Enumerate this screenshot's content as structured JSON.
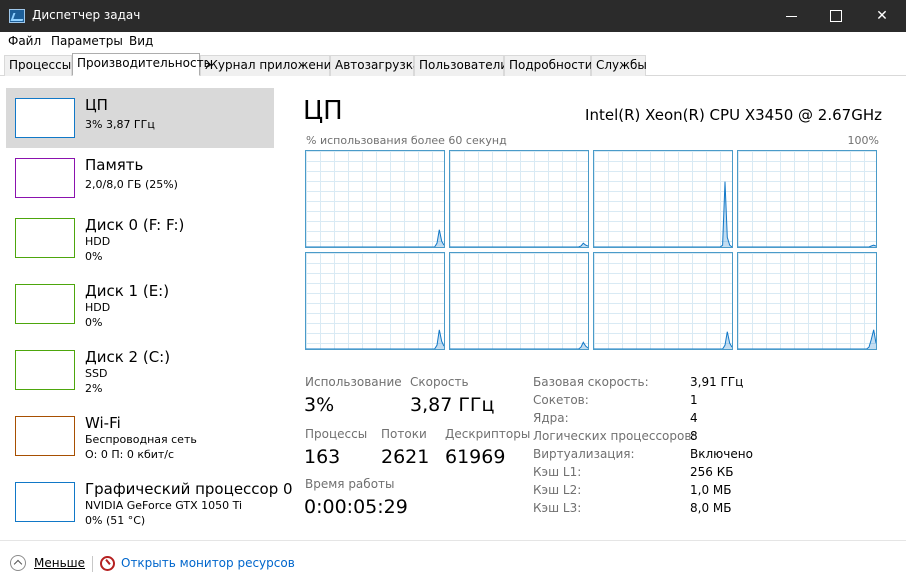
{
  "window": {
    "title": "Диспетчер задач"
  },
  "menu": [
    "Файл",
    "Параметры",
    "Вид"
  ],
  "tabs": [
    "Процессы",
    "Производительность",
    "Журнал приложений",
    "Автозагрузка",
    "Пользователи",
    "Подробности",
    "Службы"
  ],
  "active_tab": "Производительность",
  "left_items": [
    {
      "name": "ЦП",
      "sub1": "3% 3,87 ГГц",
      "sub2": "",
      "color": "#1178c7"
    },
    {
      "name": "Память",
      "sub1": "2,0/8,0 ГБ (25%)",
      "sub2": "",
      "color": "#8b12ae"
    },
    {
      "name": "Диск 0 (F: F:)",
      "sub1": "HDD",
      "sub2": "0%",
      "color": "#4da60c"
    },
    {
      "name": "Диск 1 (E:)",
      "sub1": "HDD",
      "sub2": "0%",
      "color": "#4da60c"
    },
    {
      "name": "Диск 2 (C:)",
      "sub1": "SSD",
      "sub2": "2%",
      "color": "#4da60c"
    },
    {
      "name": "Wi-Fi",
      "sub1": "Беспроводная сеть",
      "sub2": "О: 0 П: 0 кбит/с",
      "color": "#a74f01"
    },
    {
      "name": "Графический процессор 0",
      "sub1": "NVIDIA GeForce GTX 1050 Ti",
      "sub2": "0% (51 °C)",
      "color": "#1178c7"
    }
  ],
  "cpu": {
    "title": "ЦП",
    "model": "Intel(R) Xeon(R) CPU X3450 @ 2.67GHz",
    "graph_label": "% использования более 60 секунд",
    "graph_max": "100%",
    "graph_color": "#1178c7",
    "cores": [
      [
        0,
        0,
        0,
        0,
        0,
        0,
        0,
        0,
        0,
        0,
        0,
        0,
        0,
        0,
        0,
        0,
        0,
        0,
        0,
        0,
        0,
        0,
        0,
        0,
        0,
        0,
        0,
        0,
        0,
        0,
        0,
        0,
        0,
        0,
        0,
        0,
        0,
        0,
        0,
        0,
        0,
        0,
        0,
        0,
        0,
        0,
        0,
        0,
        0,
        0,
        0,
        0,
        0,
        0,
        0,
        0,
        4,
        18,
        6,
        2
      ],
      [
        0,
        0,
        0,
        0,
        0,
        0,
        0,
        0,
        0,
        0,
        0,
        0,
        0,
        0,
        0,
        0,
        0,
        0,
        0,
        0,
        0,
        0,
        0,
        0,
        0,
        0,
        0,
        0,
        0,
        0,
        0,
        0,
        0,
        0,
        0,
        0,
        0,
        0,
        0,
        0,
        0,
        0,
        0,
        0,
        0,
        0,
        0,
        0,
        0,
        0,
        0,
        0,
        0,
        0,
        0,
        0,
        1,
        4,
        2,
        1
      ],
      [
        0,
        0,
        0,
        0,
        0,
        0,
        0,
        0,
        0,
        0,
        0,
        0,
        0,
        0,
        0,
        0,
        0,
        0,
        0,
        0,
        0,
        0,
        0,
        0,
        0,
        0,
        0,
        0,
        0,
        0,
        0,
        0,
        0,
        0,
        0,
        0,
        0,
        0,
        0,
        0,
        0,
        0,
        0,
        0,
        0,
        0,
        0,
        0,
        0,
        0,
        0,
        0,
        0,
        0,
        0,
        2,
        68,
        10,
        2,
        0
      ],
      [
        0,
        0,
        0,
        0,
        0,
        0,
        0,
        0,
        0,
        0,
        0,
        0,
        0,
        0,
        0,
        0,
        0,
        0,
        0,
        0,
        0,
        0,
        0,
        0,
        0,
        0,
        0,
        0,
        0,
        0,
        0,
        0,
        0,
        0,
        0,
        0,
        0,
        0,
        0,
        0,
        0,
        0,
        0,
        0,
        0,
        0,
        0,
        0,
        0,
        0,
        0,
        0,
        0,
        0,
        0,
        0,
        0,
        1,
        2,
        1
      ],
      [
        0,
        0,
        0,
        0,
        0,
        0,
        0,
        0,
        0,
        0,
        0,
        0,
        0,
        0,
        0,
        0,
        0,
        0,
        0,
        0,
        0,
        0,
        0,
        0,
        0,
        0,
        0,
        0,
        0,
        0,
        0,
        0,
        0,
        0,
        0,
        0,
        0,
        0,
        0,
        0,
        0,
        0,
        0,
        0,
        0,
        0,
        0,
        0,
        0,
        0,
        0,
        0,
        0,
        0,
        0,
        0,
        4,
        20,
        8,
        3
      ],
      [
        0,
        0,
        0,
        0,
        0,
        0,
        0,
        0,
        0,
        0,
        0,
        0,
        0,
        0,
        0,
        0,
        0,
        0,
        0,
        0,
        0,
        0,
        0,
        0,
        0,
        0,
        0,
        0,
        0,
        0,
        0,
        0,
        0,
        0,
        0,
        0,
        0,
        0,
        0,
        0,
        0,
        0,
        0,
        0,
        0,
        0,
        0,
        0,
        0,
        0,
        0,
        0,
        0,
        0,
        0,
        0,
        2,
        7,
        3,
        1
      ],
      [
        0,
        0,
        0,
        0,
        0,
        0,
        0,
        0,
        0,
        0,
        0,
        0,
        0,
        0,
        0,
        0,
        0,
        0,
        0,
        0,
        0,
        0,
        0,
        0,
        0,
        0,
        0,
        0,
        0,
        0,
        0,
        0,
        0,
        0,
        0,
        0,
        0,
        0,
        0,
        0,
        0,
        0,
        0,
        0,
        0,
        0,
        0,
        0,
        0,
        0,
        0,
        0,
        0,
        0,
        0,
        0,
        4,
        18,
        6,
        2
      ],
      [
        0,
        0,
        0,
        0,
        0,
        0,
        0,
        0,
        0,
        0,
        0,
        0,
        0,
        0,
        0,
        0,
        0,
        0,
        0,
        0,
        0,
        0,
        0,
        0,
        0,
        0,
        0,
        0,
        0,
        0,
        0,
        0,
        0,
        0,
        0,
        0,
        0,
        0,
        0,
        0,
        0,
        0,
        0,
        0,
        0,
        0,
        0,
        0,
        0,
        0,
        0,
        0,
        0,
        0,
        0,
        0,
        2,
        10,
        20,
        6
      ]
    ],
    "stats": {
      "usage_label": "Использование",
      "usage_value": "3%",
      "speed_label": "Скорость",
      "speed_value": "3,87 ГГц",
      "processes_label": "Процессы",
      "processes_value": "163",
      "threads_label": "Потоки",
      "threads_value": "2621",
      "handles_label": "Дескрипторы",
      "handles_value": "61969",
      "uptime_label": "Время работы",
      "uptime_value": "0:00:05:29"
    },
    "details": [
      {
        "label": "Базовая скорость:",
        "value": "3,91 ГГц"
      },
      {
        "label": "Сокетов:",
        "value": "1"
      },
      {
        "label": "Ядра:",
        "value": "4"
      },
      {
        "label": "Логических процессоров:",
        "value": "8"
      },
      {
        "label": "Виртуализация:",
        "value": "Включено"
      },
      {
        "label": "Кэш L1:",
        "value": "256 КБ"
      },
      {
        "label": "Кэш L2:",
        "value": "1,0 МБ"
      },
      {
        "label": "Кэш L3:",
        "value": "8,0 МБ"
      }
    ]
  },
  "footer": {
    "less": "Меньше",
    "monitor": "Открыть монитор ресурсов"
  }
}
